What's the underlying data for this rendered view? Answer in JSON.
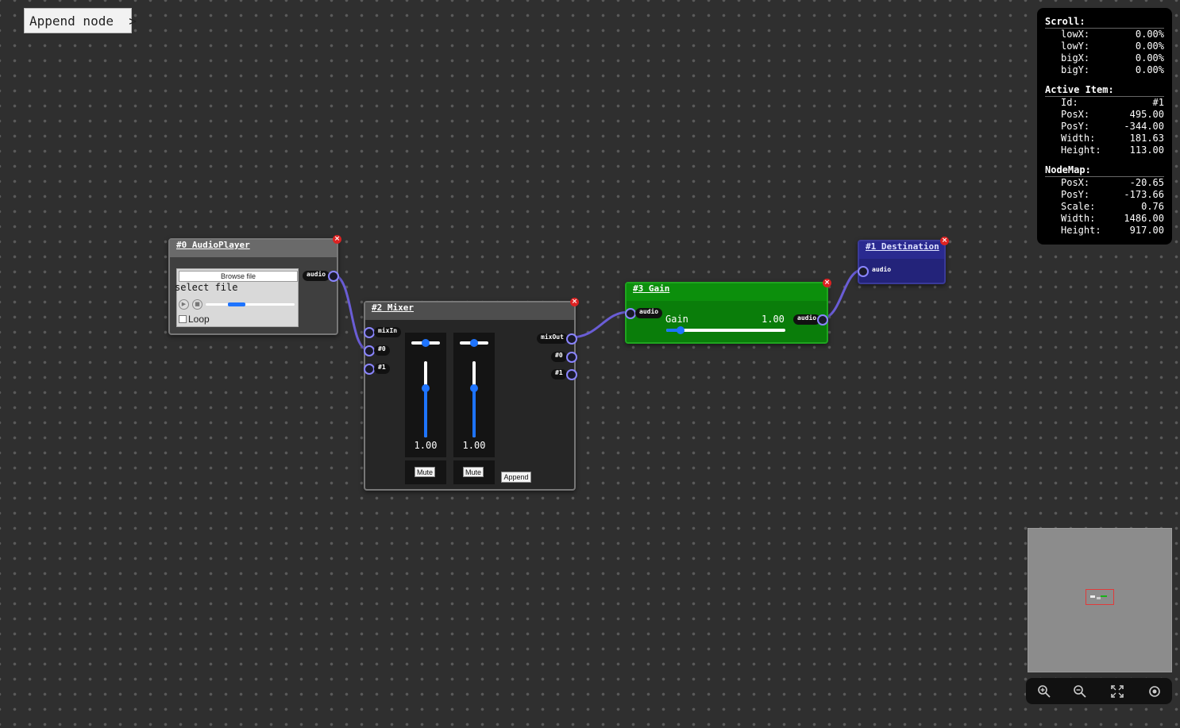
{
  "append_node": {
    "label": "Append node  >"
  },
  "colors": {
    "wire": "#6a5dd6",
    "port_ring": "#8a85ff",
    "slider_blue": "#1e74ff",
    "gain_green": "#0a7d0a",
    "dest_blue": "#23237a",
    "close_red": "#dd2222"
  },
  "nodes": {
    "audio_player": {
      "title": "#0 AudioPlayer",
      "browse_label": "Browse file",
      "select_text": "select file",
      "progress": 0.35,
      "loop_label": "Loop",
      "loop_checked": false,
      "output_port": "audio"
    },
    "mixer": {
      "title": "#2 Mixer",
      "inputs": [
        "mixIn",
        "#0",
        "#1"
      ],
      "outputs": [
        "mixOut",
        "#0",
        "#1"
      ],
      "channels": [
        {
          "pan": 0.5,
          "level_fraction": 0.65,
          "value": "1.00",
          "mute_label": "Mute"
        },
        {
          "pan": 0.5,
          "level_fraction": 0.65,
          "value": "1.00",
          "mute_label": "Mute"
        }
      ],
      "append_label": "Append"
    },
    "gain": {
      "title": "#3 Gain",
      "input_port": "audio",
      "output_port": "audio",
      "label": "Gain",
      "value": "1.00",
      "slider_fraction": 0.12
    },
    "destination": {
      "title": "#1 Destination",
      "input_port": "audio"
    }
  },
  "info_panel": {
    "scroll": {
      "heading": "Scroll:",
      "rows": [
        {
          "k": "lowX:",
          "v": "0.00%"
        },
        {
          "k": "lowY:",
          "v": "0.00%"
        },
        {
          "k": "bigX:",
          "v": "0.00%"
        },
        {
          "k": "bigY:",
          "v": "0.00%"
        }
      ]
    },
    "active": {
      "heading": "Active Item:",
      "rows": [
        {
          "k": "Id:",
          "v": "#1"
        },
        {
          "k": "PosX:",
          "v": "495.00"
        },
        {
          "k": "PosY:",
          "v": "-344.00"
        },
        {
          "k": "Width:",
          "v": "181.63"
        },
        {
          "k": "Height:",
          "v": "113.00"
        }
      ]
    },
    "nodemap": {
      "heading": "NodeMap:",
      "rows": [
        {
          "k": "PosX:",
          "v": "-20.65"
        },
        {
          "k": "PosY:",
          "v": "-173.66"
        },
        {
          "k": "Scale:",
          "v": "0.76"
        },
        {
          "k": "Width:",
          "v": "1486.00"
        },
        {
          "k": "Height:",
          "v": "917.00"
        }
      ]
    }
  },
  "toolbar": {
    "tools": [
      "zoom-in-icon",
      "zoom-out-icon",
      "fit-screen-icon",
      "center-icon"
    ]
  }
}
